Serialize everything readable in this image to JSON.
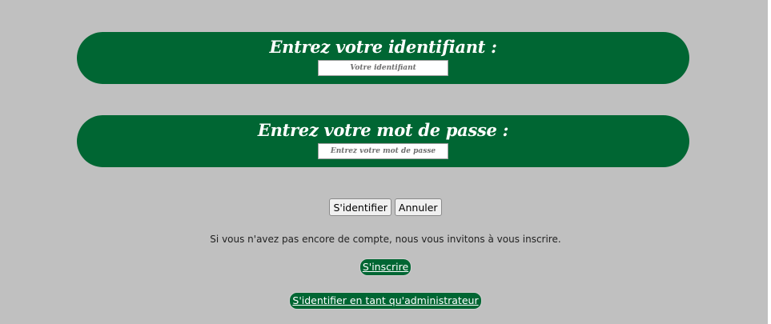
{
  "colors": {
    "background": "#c0c0c0",
    "accent_green": "#006633",
    "text_white": "#ffffff"
  },
  "login_panel": {
    "title": "Entrez votre identifiant :",
    "input_placeholder": "Votre identifiant",
    "input_value": ""
  },
  "password_panel": {
    "title": "Entrez votre mot de passe :",
    "input_placeholder": "Entrez votre mot de passe",
    "input_value": ""
  },
  "actions": {
    "submit_label": "S'identifier",
    "cancel_label": "Annuler"
  },
  "invite_text": "Si vous n'avez pas encore de compte, nous vous invitons à vous inscrire.",
  "links": {
    "register_label": "S'inscrire",
    "admin_label": "S'identifier en tant qu'administrateur"
  }
}
